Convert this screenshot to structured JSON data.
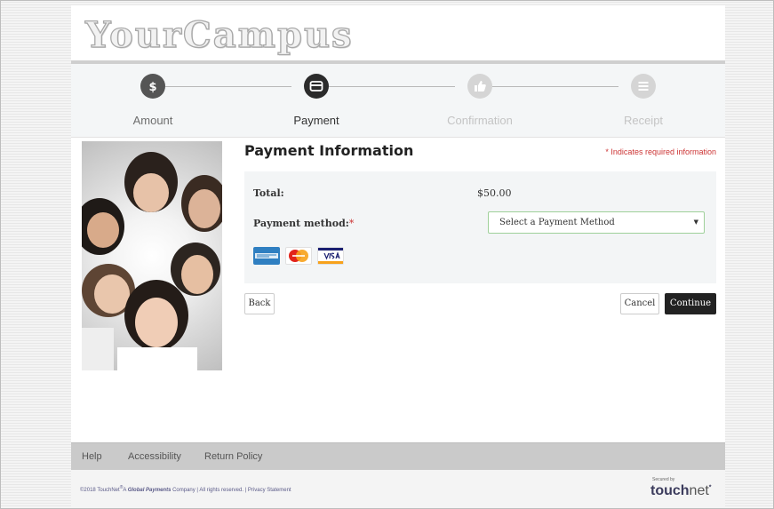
{
  "header": {
    "logo_text": "YourCampus"
  },
  "steps": [
    {
      "label": "Amount",
      "icon": "dollar-icon",
      "state": "done"
    },
    {
      "label": "Payment",
      "icon": "credit-card-icon",
      "state": "active"
    },
    {
      "label": "Confirmation",
      "icon": "thumbs-up-icon",
      "state": "todo"
    },
    {
      "label": "Receipt",
      "icon": "list-icon",
      "state": "todo"
    }
  ],
  "main": {
    "title": "Payment Information",
    "required_note": "* Indicates required information",
    "total_label": "Total:",
    "total_value": "$50.00",
    "method_label": "Payment method:",
    "method_required_mark": "*",
    "method_select": {
      "selected": "Select a Payment Method"
    },
    "cards": [
      {
        "name": "amex-icon",
        "text": "AMERICAN EXPRESS"
      },
      {
        "name": "mastercard-icon",
        "text": "MasterCard"
      },
      {
        "name": "visa-icon",
        "text": "VISA"
      }
    ]
  },
  "actions": {
    "back": "Back",
    "cancel": "Cancel",
    "continue": "Continue"
  },
  "footer": {
    "links": [
      "Help",
      "Accessibility",
      "Return Policy"
    ],
    "copyright_pre": "©2018 TouchNet",
    "copyright_mid": "A",
    "copyright_company": "Global Payments",
    "copyright_post": "Company | All rights reserved. | Privacy Statement",
    "secured_by": "Secured by",
    "brand_bold": "touch",
    "brand_rest": "net"
  },
  "colors": {
    "accent_dark": "#222222",
    "required_red": "#cc3333",
    "select_border": "#9fd09a"
  }
}
